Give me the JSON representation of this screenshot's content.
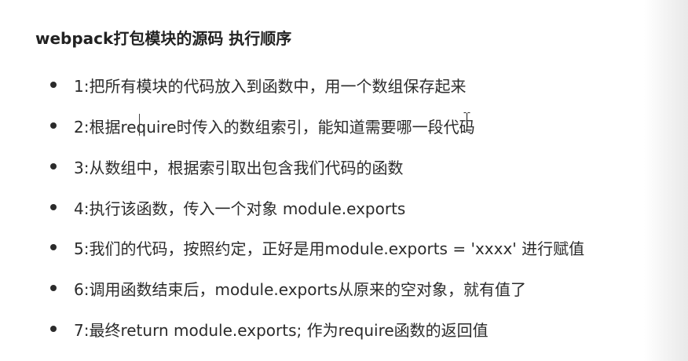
{
  "slide": {
    "title": "webpack打包模块的源码 执行顺序",
    "items": [
      {
        "text": "1:把所有模块的代码放入到函数中，用一个数组保存起来"
      },
      {
        "text": "2:根据require时传入的数组索引，能知道需要哪一段代码"
      },
      {
        "text": "3:从数组中，根据索引取出包含我们代码的函数"
      },
      {
        "text": "4:执行该函数，传入一个对象 module.exports"
      },
      {
        "text": "5:我们的代码，按照约定，正好是用module.exports = 'xxxx' 进行赋值"
      },
      {
        "text": "6:调用函数结束后，module.exports从原来的空对象，就有值了"
      },
      {
        "text": "7:最终return module.exports; 作为require函数的返回值"
      }
    ]
  }
}
